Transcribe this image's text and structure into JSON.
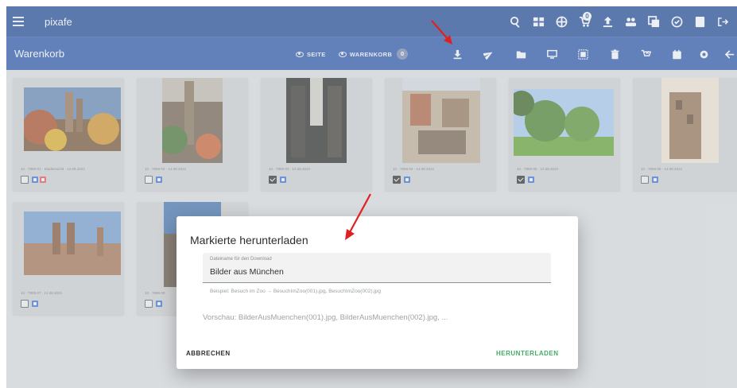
{
  "header": {
    "title": "pixafe",
    "notification_count": "0"
  },
  "subbar": {
    "title": "Warenkorb",
    "toggle_page": "SEITE",
    "toggle_cart": "WARENKORB",
    "cart_count": "0"
  },
  "cards": [
    {
      "caption": "10 · 7899-01 · Stadtansicht · 12.08.2022",
      "checked": false,
      "tags": [
        "#2f67c9",
        "#d94b4b"
      ]
    },
    {
      "caption": "10 · 7899-02 · 12.08.2022",
      "checked": false,
      "tags": [
        "#2f67c9"
      ]
    },
    {
      "caption": "10 · 7899-03 · 12.08.2022",
      "checked": true,
      "tags": [
        "#2f67c9"
      ]
    },
    {
      "caption": "10 · 7899-04 · 12.08.2022",
      "checked": true,
      "tags": [
        "#2f67c9"
      ]
    },
    {
      "caption": "10 · 7899-05 · 12.08.2022",
      "checked": true,
      "tags": [
        "#2f67c9"
      ]
    },
    {
      "caption": "10 · 7899-06 · 12.08.2022",
      "checked": false,
      "tags": [
        "#2f67c9"
      ]
    },
    {
      "caption": "10 · 7899-07 · 12.08.2022",
      "checked": false,
      "tags": [
        "#2f67c9"
      ]
    },
    {
      "caption": "10 · 7899-08",
      "checked": false,
      "tags": [
        "#2f67c9"
      ]
    }
  ],
  "dialog": {
    "title": "Markierte herunterladen",
    "field_label": "Dateiname für den Download",
    "field_value": "Bilder aus München",
    "hint": "Beispiel: Besuch im Zoo → BesuchImZoo(001).jpg, BesuchImZoo(002).jpg",
    "preview": "Vorschau: BilderAusMuenchen(001).jpg, BilderAusMuenchen(002).jpg, ...",
    "cancel_label": "ABBRECHEN",
    "download_label": "HERUNTERLADEN"
  },
  "colors": {
    "header": "#153f8e",
    "subbar": "#1e4aa1",
    "accent_green": "#3fae63",
    "annotation_arrow": "#e02020"
  }
}
